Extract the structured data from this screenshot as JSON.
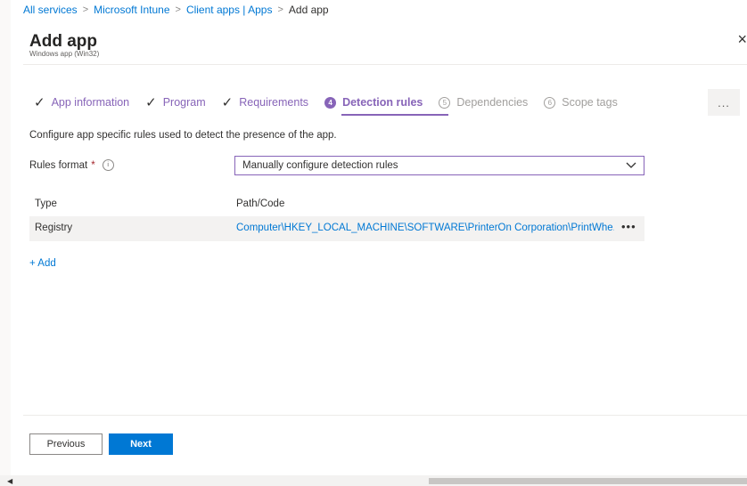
{
  "breadcrumb": {
    "items": [
      "All services",
      "Microsoft Intune",
      "Client apps | Apps",
      "Add app"
    ],
    "separator": ">"
  },
  "header": {
    "title": "Add app",
    "subtitle": "Windows app (Win32)",
    "close_icon": "×"
  },
  "steps": [
    {
      "label": "App information",
      "state": "done",
      "marker": "✓"
    },
    {
      "label": "Program",
      "state": "done",
      "marker": "✓"
    },
    {
      "label": "Requirements",
      "state": "done",
      "marker": "✓"
    },
    {
      "label": "Detection rules",
      "state": "active",
      "marker": "4"
    },
    {
      "label": "Dependencies",
      "state": "future",
      "marker": "5"
    },
    {
      "label": "Scope tags",
      "state": "future",
      "marker": "6"
    }
  ],
  "steps_more": "...",
  "form": {
    "description": "Configure app specific rules used to detect the presence of the app.",
    "rules_format_label": "Rules format",
    "required_marker": "*",
    "info_icon": "i",
    "rules_format_value": "Manually configure detection rules"
  },
  "table": {
    "headers": [
      "Type",
      "Path/Code"
    ],
    "rows": [
      {
        "type": "Registry",
        "path": "Computer\\HKEY_LOCAL_MACHINE\\SOFTWARE\\PrinterOn Corporation\\PrintWhe...",
        "more": "•••"
      }
    ],
    "add_label": "+ Add"
  },
  "footer": {
    "previous_label": "Previous",
    "next_label": "Next"
  },
  "colors": {
    "accent_purple": "#8764b8",
    "link_blue": "#0078d4",
    "row_bg": "#f3f2f1"
  }
}
